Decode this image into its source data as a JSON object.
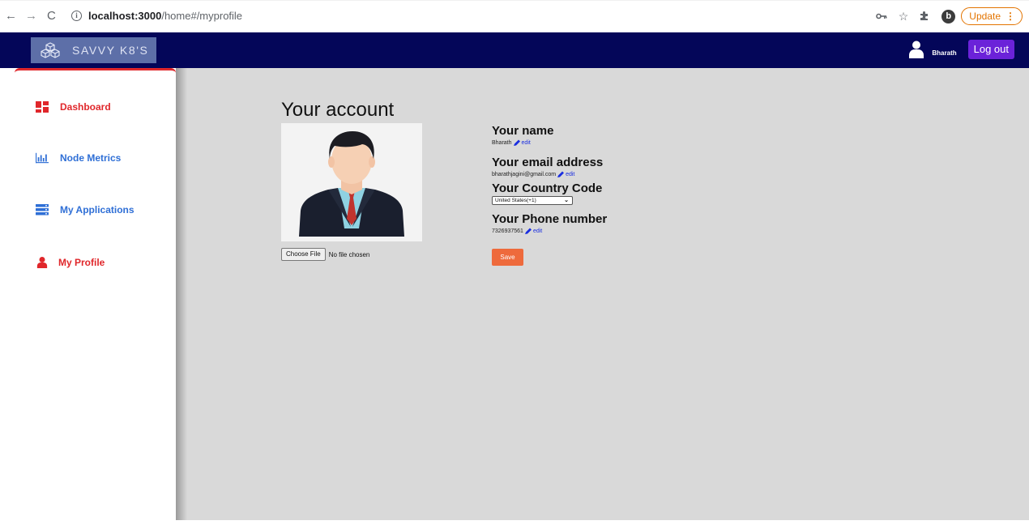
{
  "browser": {
    "back_glyph": "←",
    "forward_glyph": "→",
    "reload_glyph": "C",
    "info_glyph": "i",
    "url_host": "localhost:3000",
    "url_path": "/home#/myprofile",
    "key_icon": "key-icon",
    "star_icon": "star-icon",
    "puzzle_icon": "extensions-icon",
    "profile_initial": "b",
    "update_label": "Update",
    "menu_glyph": "⋮"
  },
  "header": {
    "brand_text": "SAVVY K8'S",
    "user_name": "Bharath",
    "logout_label": "Log out",
    "bg_color": "#040659"
  },
  "sidebar": {
    "items": [
      {
        "label": "Dashboard",
        "icon": "dashboard-icon",
        "color": "#e0272b"
      },
      {
        "label": "Node Metrics",
        "icon": "bar-chart-icon",
        "color": "#2f6fd6"
      },
      {
        "label": "My Applications",
        "icon": "server-icon",
        "color": "#2f6fd6"
      },
      {
        "label": "My Profile",
        "icon": "user-icon",
        "color": "#e0272b"
      }
    ]
  },
  "profile": {
    "title": "Your account",
    "choose_file_label": "Choose File",
    "no_file_text": "No file chosen",
    "name_label": "Your name",
    "name_value": "Bharath",
    "email_label": "Your email address",
    "email_value": "bharathjagini@gmail.com",
    "country_label": "Your Country Code",
    "country_value": "United States(+1)",
    "phone_label": "Your Phone number",
    "phone_value": "7326937561",
    "edit_label": "edit",
    "save_label": "Save",
    "save_color": "#ee6a3c"
  }
}
